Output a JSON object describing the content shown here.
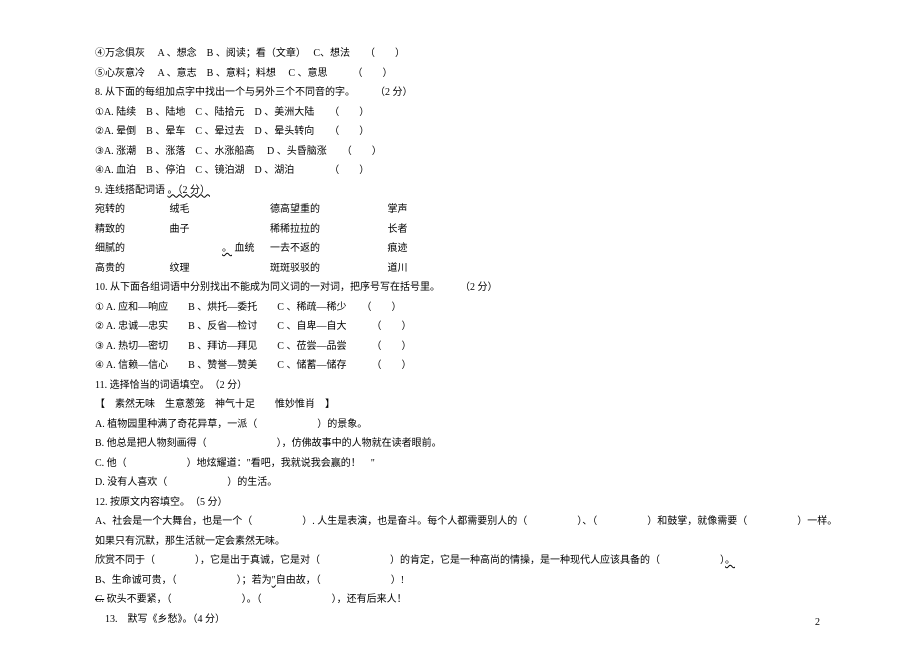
{
  "q7_items": {
    "l4": "④万念俱灰　 A 、想念　B 、阅读；看（文章）　 C、想法　　（　　）",
    "l5": "⑤心灰意冷　 A 、意志　B 、意料；料想　 C 、意思　　　（　　）"
  },
  "q8": {
    "stem": "8. 从下面的每组加点字中找出一个与另外三个不同音的字。　　　（2 分）",
    "l1": "①A. 陆续　B 、陆地　C 、陆拾元　D 、美洲大陆　　（　　）",
    "l2": "②A. 晕倒　B 、晕车　C 、晕过去　D 、晕头转向　　（　　）",
    "l3": "③A. 涨潮　B 、涨落　C 、水涨船高　 D 、头昏脑涨　　（　　）",
    "l4": "④A. 血泊　B 、停泊　C 、镜泊湖　D 、湖泊　　　　（　　）"
  },
  "q9": {
    "stem_a": "9. 连线搭配词语 ",
    "stem_b": "。（2 分）",
    "rows": [
      [
        "宛转的",
        "绒毛",
        "德高望重的",
        "掌声"
      ],
      [
        "精致的",
        "曲子",
        "稀稀拉拉的",
        "长者"
      ],
      [
        "细腻的",
        "血统",
        "一去不返的",
        "痕迹"
      ],
      [
        "高贵的",
        "纹理",
        "斑斑驳驳的",
        "道川"
      ]
    ],
    "row2_leadspace": "　　　　　 ",
    "row2_wave": "。"
  },
  "q10": {
    "stem": "10. 从下面各组词语中分别找出不能成为同义词的一对词，把序号写在括号里。　　　（2 分）",
    "l1": "① A. 应和—响应　　B 、烘托—委托　　C 、稀疏—稀少　　（　　）",
    "l2": "② A. 忠诚—忠实　　B 、反省—检讨　　C 、自卑—自大　　　（　　）",
    "l3": "③ A. 热切—密切　　B 、拜访—拜见　　C 、莅尝—品尝　　　（　　）",
    "l4": "④ A. 信赖—信心　　B 、赞誉—赞美　　C 、储蓄—储存　　　（　　）"
  },
  "q11": {
    "stem": "11. 选择恰当的词语填空。　（2 分）",
    "options": "【　素然无味　生意葱笼　神气十足　　惟妙惟肖　】",
    "A": "A. 植物园里种满了奇花异草，一派（　　　　　　）的景象。",
    "B": "B. 他总是把人物刻画得（　　　　　　　），仿佛故事中的人物就在读者眼前。",
    "C": "C. 他（　　　　　　）地炫耀道：\"看吧，我就说我会赢的！　\"",
    "D": "D. 没有人喜欢（　　　　　　）的生活。"
  },
  "q12": {
    "stem": "12. 按原文内容填空。　（5 分）",
    "A": "A、社会是一个大舞台，也是一个（　　　　　）. 人生是表演，也是奋斗。每个人都需要别人的（　　　　　）、（　　　　　）和鼓掌，就像需要（　　　　　）一样。",
    "A2": "如果只有沉默，那生活就一定会素然无味。",
    "A3a": "欣赏不同于（　　　　），它是出于真诚，它是对（　　　　　　　）的肯定，它是一种高尚的情操，是一种现代人应该具备的（　　　　　　）",
    "A3b": "。",
    "B": "B、生命诚可贵，（　　　　　　）；若为",
    "B_wave": "\"",
    "B_after": "自由故，（　　　　　　　）!",
    "C_strike": "C.",
    "C": " 砍头不要紧，（　　　　　　　）。（　　　　　　　），还有后来人！"
  },
  "q13": {
    "stem": "　13.　默写《乡愁》。（4 分）"
  },
  "page_number": "2"
}
